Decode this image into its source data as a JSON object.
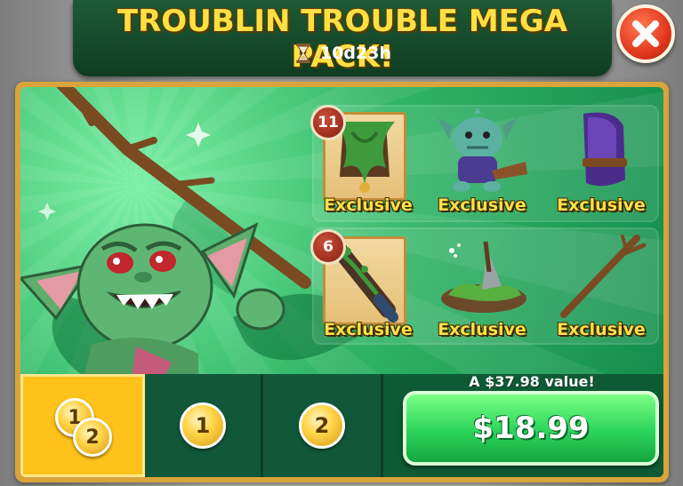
{
  "header": {
    "title": "TROUBLIN TROUBLE MEGA PACK!",
    "timer": "10d23h",
    "timer_icon": "hourglass-icon"
  },
  "close_icon": "close-icon",
  "items_row1": [
    {
      "badge": "11",
      "label": "Exclusive",
      "icon": "leaf-cloak-card-icon"
    },
    {
      "label": "Exclusive",
      "icon": "troublin-goblin-icon"
    },
    {
      "label": "Exclusive",
      "icon": "purple-hood-icon"
    }
  ],
  "items_row2": [
    {
      "badge": "6",
      "label": "Exclusive",
      "icon": "vine-club-card-icon"
    },
    {
      "label": "Exclusive",
      "icon": "goblin-camp-icon"
    },
    {
      "label": "Exclusive",
      "icon": "wooden-stick-icon"
    }
  ],
  "tiers": [
    {
      "coins": [
        "1",
        "2"
      ],
      "selected": true
    },
    {
      "coins": [
        "1"
      ],
      "selected": false
    },
    {
      "coins": [
        "2"
      ],
      "selected": false
    }
  ],
  "value_text": "A $37.98 value!",
  "price": "$18.99",
  "colors": {
    "banner": "#1e5a35",
    "title": "#ffe044",
    "panel_border": "#d9a53a",
    "selected_tier": "#ffc21a",
    "buy_button": "#2bd45a",
    "close_button": "#e2381d"
  }
}
